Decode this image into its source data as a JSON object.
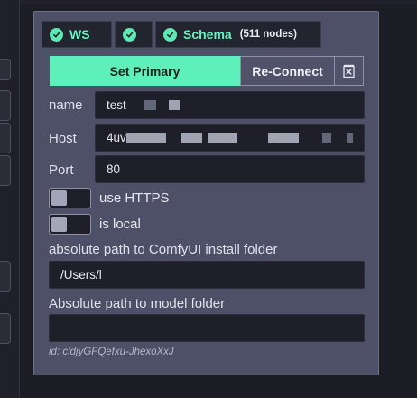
{
  "status_tabs": [
    {
      "label": "WS",
      "sub": ""
    },
    {
      "label": "",
      "sub": ""
    },
    {
      "label": "Schema",
      "sub": "(511 nodes)"
    }
  ],
  "actions": {
    "primary": "Set Primary",
    "secondary": "Re-Connect",
    "delete_icon": "delete-icon"
  },
  "fields": {
    "name": {
      "label": "name",
      "value": "test"
    },
    "host": {
      "label": "Host",
      "value": "4uv"
    },
    "port": {
      "label": "Port",
      "value": "80"
    }
  },
  "toggles": {
    "https": {
      "label": "use HTTPS",
      "on": false
    },
    "local": {
      "label": "is local",
      "on": false
    }
  },
  "paths": {
    "install": {
      "label": "absolute path to ComfyUI install folder",
      "value": "/Users/l"
    },
    "model": {
      "label": "Absolute path to model folder",
      "value": ""
    }
  },
  "id_text": "id: cldjyGFQefxu-JhexoXxJ",
  "colors": {
    "accent": "#5ef0bb",
    "panel": "#4d5066",
    "input_bg": "#1e1f29"
  }
}
